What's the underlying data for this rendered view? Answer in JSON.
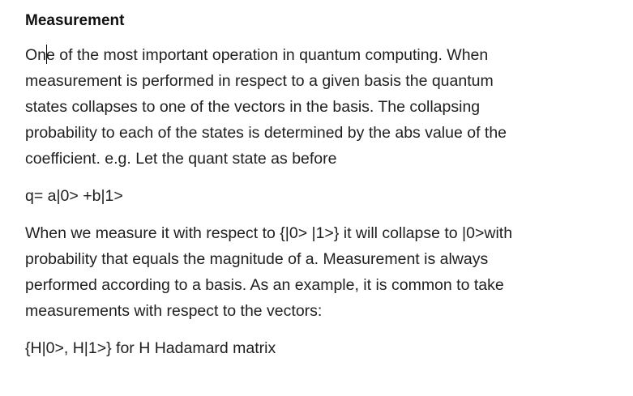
{
  "document": {
    "heading": "Measurement",
    "paragraph1": {
      "lines": [
        "One of the most important operation in quantum computing. When",
        "measurement is performed in respect to a given basis the quantum",
        "states collapses to one of the vectors in the basis. The collapsing",
        "probability to each of the states is determined by the abs value of the",
        "coefficient. e.g.  Let the quant state as before"
      ]
    },
    "equation": "q= a|0> +b|1>",
    "paragraph2": {
      "lines": [
        "When we measure it with respect to {|0> |1>} it will collapse to |0>with",
        "probability that equals the magnitude of a. Measurement is always",
        "performed according to a basis. As an example, it is common to take",
        "measurements with respect to the vectors:"
      ]
    },
    "basis_example": "{H|0>, H|1>} for H Hadamard matrix",
    "caret_split": {
      "before": "On",
      "after": "e of the most important operation in quantum computing. When"
    }
  }
}
